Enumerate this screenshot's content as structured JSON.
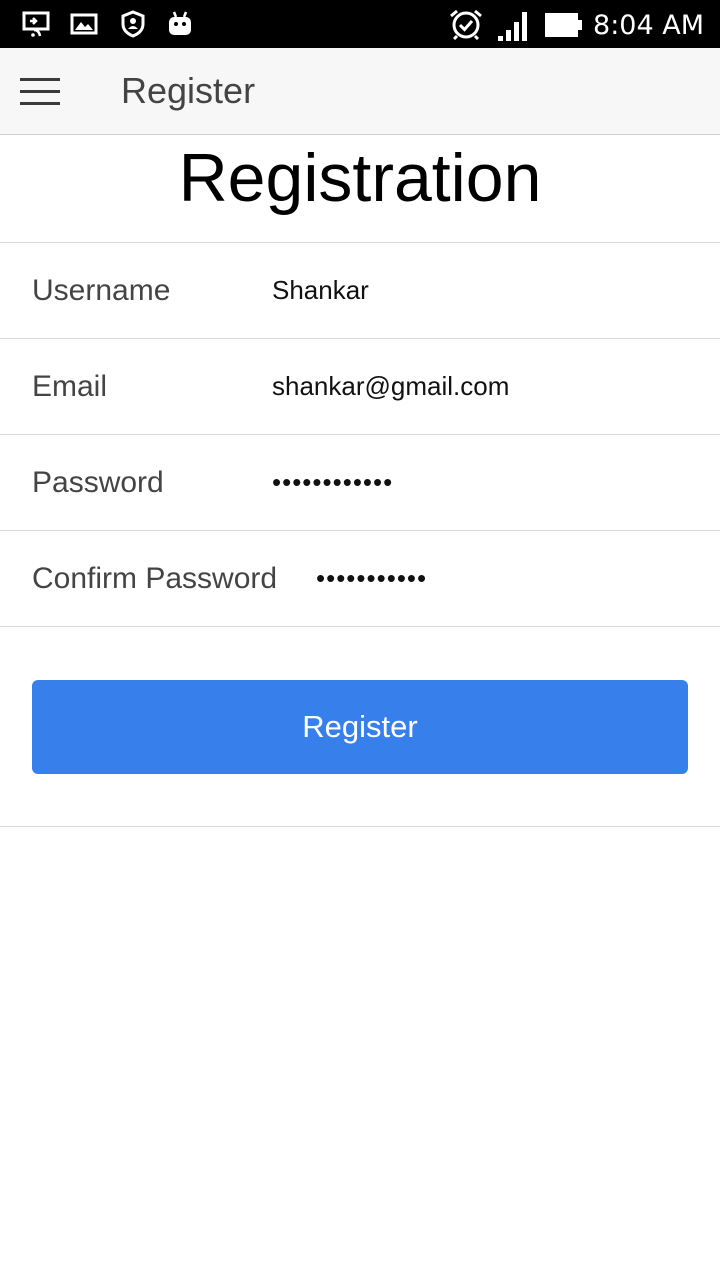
{
  "status_bar": {
    "time": "8:04 AM",
    "icons": [
      "cast-icon",
      "gallery-icon",
      "shield-icon",
      "android-icon",
      "alarm-icon",
      "signal-icon",
      "battery-icon"
    ]
  },
  "app_bar": {
    "title": "Register",
    "menu_icon": "hamburger-menu-icon"
  },
  "page": {
    "heading": "Registration"
  },
  "form": {
    "username": {
      "label": "Username",
      "value": "Shankar"
    },
    "email": {
      "label": "Email",
      "value": "shankar@gmail.com"
    },
    "password": {
      "label": "Password",
      "value": "••••••••••••"
    },
    "confirm_password": {
      "label": "Confirm Password",
      "value": "•••••••••••"
    },
    "submit_label": "Register"
  },
  "colors": {
    "primary": "#3780ec",
    "status_bar": "#000000",
    "app_bar": "#f7f7f7"
  }
}
